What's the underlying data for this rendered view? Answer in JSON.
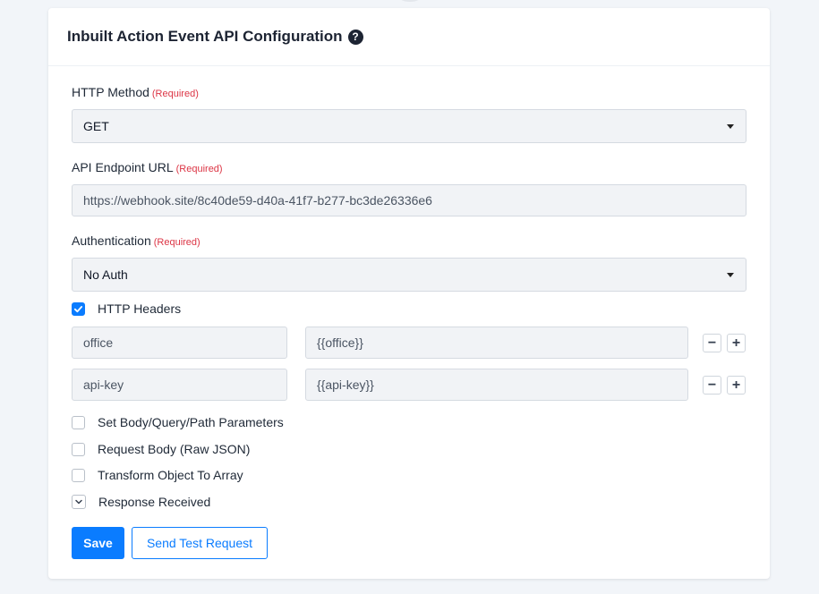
{
  "card": {
    "title": "Inbuilt Action Event API Configuration",
    "help_icon": "question-circle-icon"
  },
  "http_method": {
    "label": "HTTP Method",
    "required": "(Required)",
    "value": "GET"
  },
  "endpoint": {
    "label": "API Endpoint URL",
    "required": "(Required)",
    "value": "https://webhook.site/8c40de59-d40a-41f7-b277-bc3de26336e6"
  },
  "authentication": {
    "label": "Authentication",
    "required": "(Required)",
    "value": "No Auth"
  },
  "http_headers": {
    "label": "HTTP Headers",
    "checked": true,
    "rows": [
      {
        "key": "office",
        "value": "{{office}}",
        "remove": "−",
        "add": "+"
      },
      {
        "key": "api-key",
        "value": "{{api-key}}",
        "remove": "−",
        "add": "+"
      }
    ]
  },
  "options": [
    {
      "label": "Set Body/Query/Path Parameters",
      "checked": false
    },
    {
      "label": "Request Body (Raw JSON)",
      "checked": false
    },
    {
      "label": "Transform Object To Array",
      "checked": false
    },
    {
      "label": "Response Received",
      "checked": true,
      "style": "chevron"
    }
  ],
  "buttons": {
    "save": "Save",
    "send_test": "Send Test Request"
  },
  "colors": {
    "primary": "#0a7cff",
    "required": "#dc3545"
  }
}
